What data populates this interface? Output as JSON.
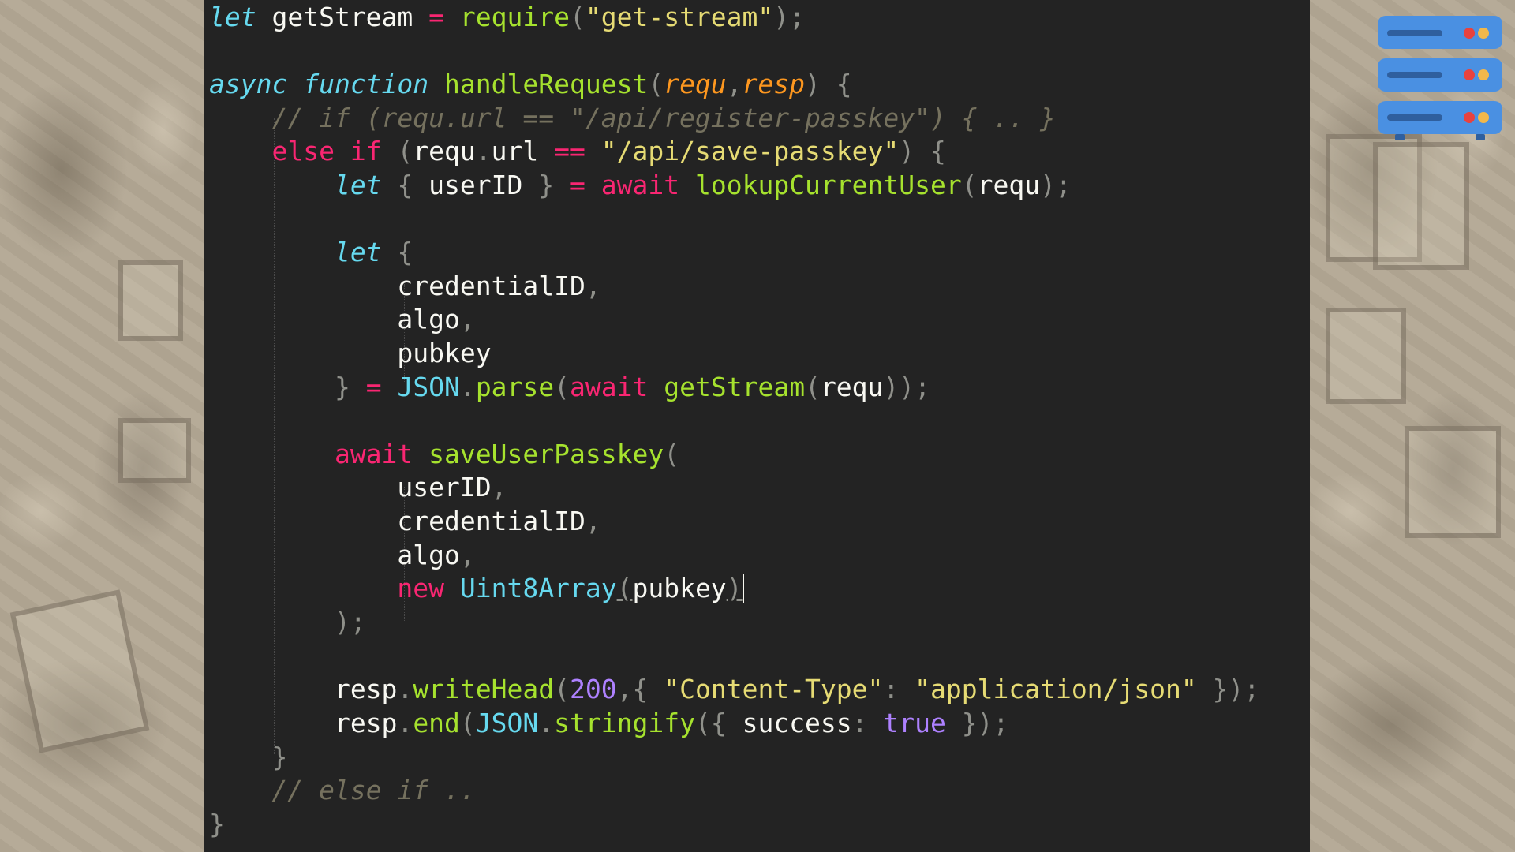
{
  "code": {
    "l1": {
      "let": "let",
      "name": " getStream ",
      "eq": "=",
      "sp": " ",
      "req": "require",
      "p1": "(",
      "str": "\"get-stream\"",
      "p2": ");"
    },
    "l3": {
      "async": "async",
      "sp1": " ",
      "function": "function",
      "sp2": " ",
      "name": "handleRequest",
      "p1": "(",
      "a1": "requ",
      "comma": ",",
      "a2": "resp",
      "p2": ")",
      "sp3": " ",
      "brace": "{"
    },
    "l4": {
      "indent": "    ",
      "comment": "// if (requ.url == \"/api/register-passkey\") { .. }"
    },
    "l5": {
      "indent": "    ",
      "else_if": "else if",
      "sp1": " ",
      "p1": "(",
      "obj": "requ",
      "dot": ".",
      "prop": "url",
      "sp2": " ",
      "op": "==",
      "sp3": " ",
      "str": "\"/api/save-passkey\"",
      "p2": ")",
      "sp4": " ",
      "brace": "{"
    },
    "l6": {
      "indent": "        ",
      "let": "let",
      "sp1": " ",
      "b1": "{",
      "var": " userID ",
      "b2": "}",
      "sp2": " ",
      "eq": "=",
      "sp3": " ",
      "await": "await",
      "sp4": " ",
      "fn": "lookupCurrentUser",
      "p1": "(",
      "arg": "requ",
      "p2": ");"
    },
    "l8": {
      "indent": "        ",
      "let": "let",
      "sp": " ",
      "brace": "{"
    },
    "l9": {
      "indent": "            ",
      "name": "credentialID",
      "comma": ","
    },
    "l10": {
      "indent": "            ",
      "name": "algo",
      "comma": ","
    },
    "l11": {
      "indent": "            ",
      "name": "pubkey"
    },
    "l12": {
      "indent": "        ",
      "brace": "}",
      "sp1": " ",
      "eq": "=",
      "sp2": " ",
      "json": "JSON",
      "dot": ".",
      "fn": "parse",
      "p1": "(",
      "await": "await",
      "sp3": " ",
      "fn2": "getStream",
      "p2": "(",
      "arg": "requ",
      "p3": "));"
    },
    "l14": {
      "indent": "        ",
      "await": "await",
      "sp": " ",
      "fn": "saveUserPasskey",
      "p1": "("
    },
    "l15": {
      "indent": "            ",
      "name": "userID",
      "comma": ","
    },
    "l16": {
      "indent": "            ",
      "name": "credentialID",
      "comma": ","
    },
    "l17": {
      "indent": "            ",
      "name": "algo",
      "comma": ","
    },
    "l18": {
      "indent": "            ",
      "new": "new",
      "sp": " ",
      "cls": "Uint8Array",
      "p1": "(",
      "arg": "pubkey",
      "p2": ")"
    },
    "l19": {
      "indent": "        ",
      "close": ");"
    },
    "l21": {
      "indent": "        ",
      "obj": "resp",
      "dot": ".",
      "fn": "writeHead",
      "p1": "(",
      "num": "200",
      "comma": ",",
      "b1": "{",
      "sp1": " ",
      "key": "\"Content-Type\"",
      "colon": ":",
      "sp2": " ",
      "val": "\"application/json\"",
      "sp3": " ",
      "b2": "});"
    },
    "l22": {
      "indent": "        ",
      "obj": "resp",
      "dot": ".",
      "fn": "end",
      "p1": "(",
      "json": "JSON",
      "dot2": ".",
      "fn2": "stringify",
      "p2": "({",
      "key": " success",
      "colon": ":",
      "sp": " ",
      "val": "true",
      "p3": " });"
    },
    "l23": {
      "indent": "    ",
      "brace": "}"
    },
    "l24": {
      "indent": "    ",
      "comment": "// else if .."
    },
    "l25": {
      "brace": "}"
    }
  },
  "server_icon": {
    "name": "server-rack-icon",
    "body_color": "#4a90e2",
    "led_red": "#e8423f",
    "led_yellow": "#f2b84b"
  },
  "colors": {
    "editor_bg": "#232323",
    "keyword": "#f92672",
    "function": "#a6e22e",
    "string": "#e6db74",
    "storage": "#66d9ef",
    "param": "#fd971f",
    "comment": "#75715e",
    "number": "#ae81ff"
  }
}
